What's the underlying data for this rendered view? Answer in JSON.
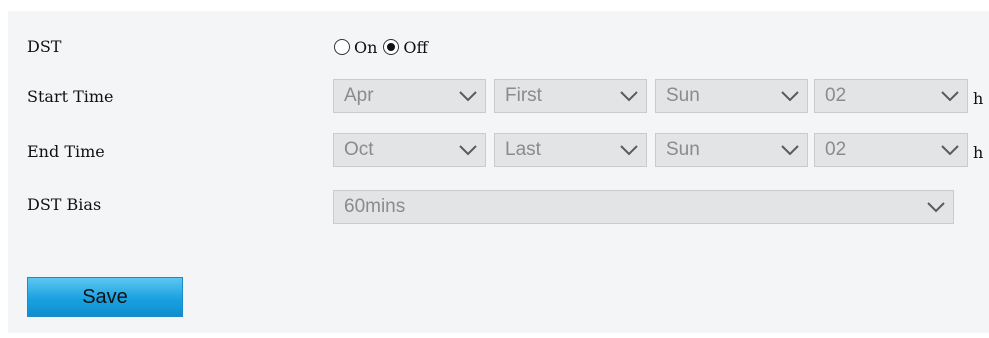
{
  "dst": {
    "label": "DST",
    "options": [
      {
        "label": "On",
        "checked": false
      },
      {
        "label": "Off",
        "checked": true
      }
    ]
  },
  "start_time": {
    "label": "Start Time",
    "month": "Apr",
    "week": "First",
    "day": "Sun",
    "hour": "02",
    "unit": "h"
  },
  "end_time": {
    "label": "End Time",
    "month": "Oct",
    "week": "Last",
    "day": "Sun",
    "hour": "02",
    "unit": "h"
  },
  "dst_bias": {
    "label": "DST Bias",
    "value": "60mins"
  },
  "save_label": "Save",
  "colors": {
    "panel_bg": "#f4f5f7",
    "select_bg": "#e3e4e6",
    "select_text": "#8a8b8e",
    "button_blue": "#1aa1e0"
  },
  "icons": {
    "dropdown": "chevron-down-icon",
    "radio": "radio-button"
  }
}
